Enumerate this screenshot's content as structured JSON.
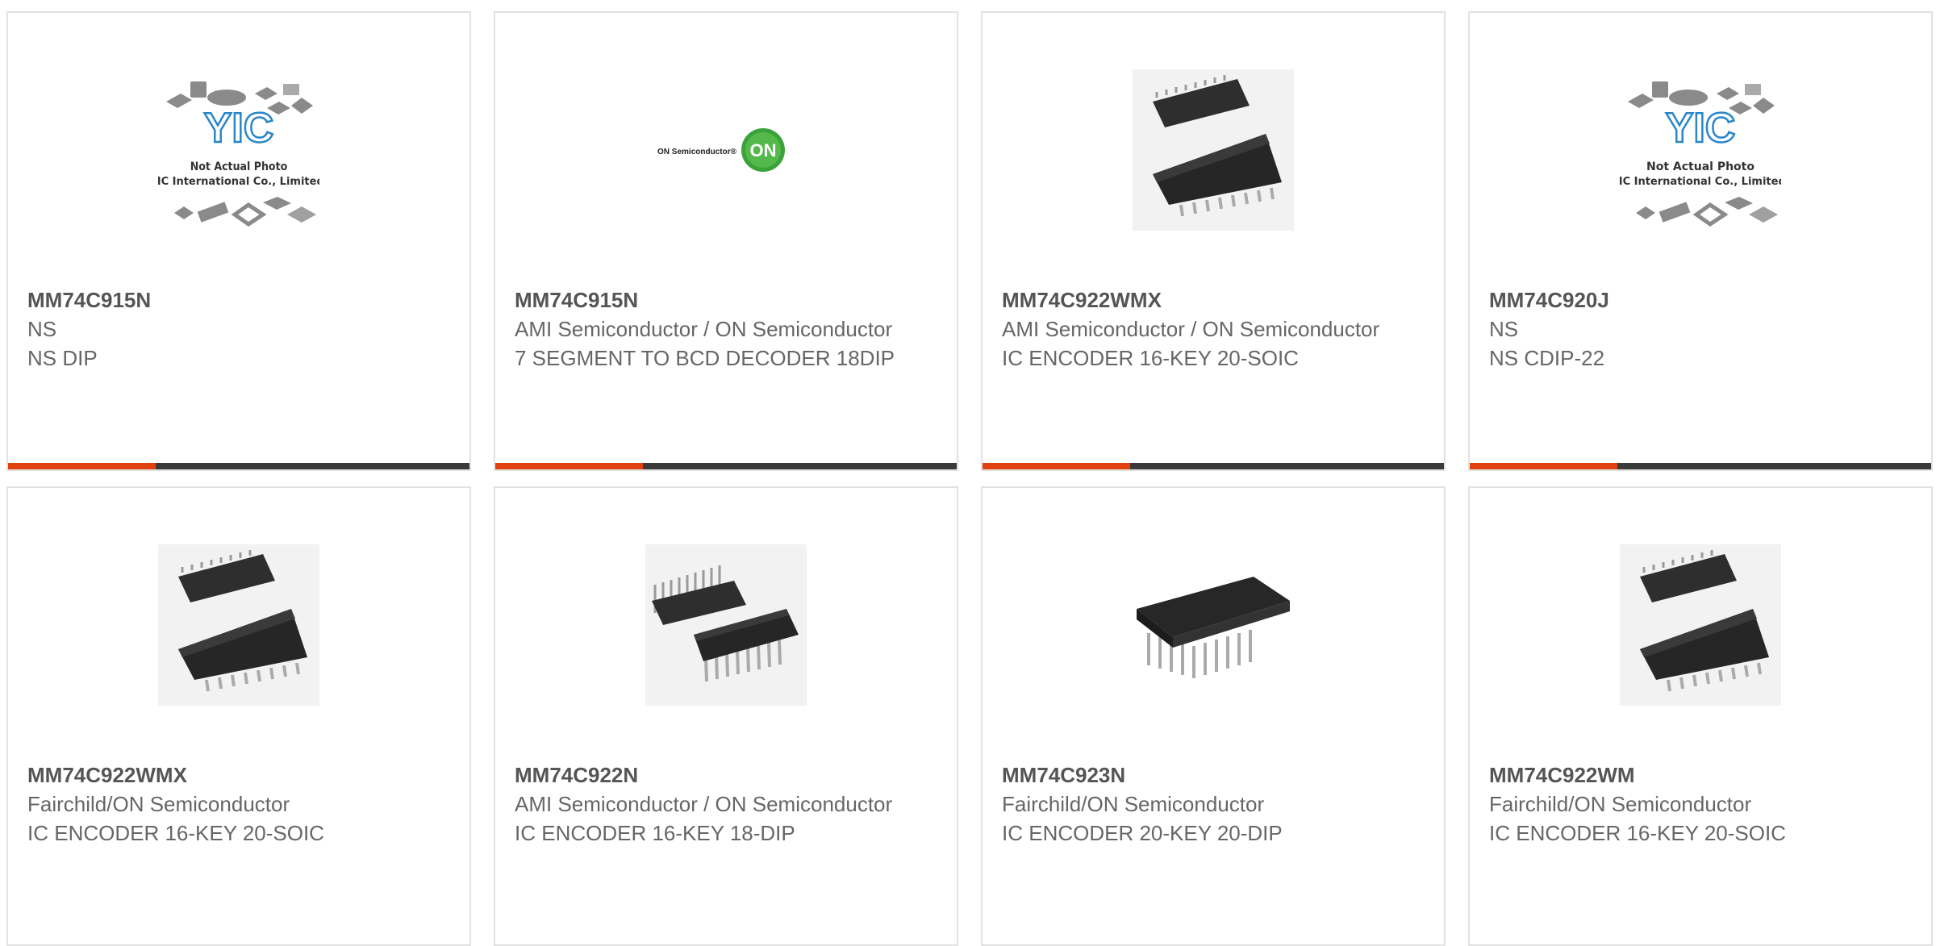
{
  "colors": {
    "accent": "#e2420f",
    "bar": "#3a3a3a",
    "border": "#e2e2e2",
    "text": "#666666"
  },
  "products": [
    {
      "part": "MM74C915N",
      "manufacturer": "NS",
      "description": "NS DIP",
      "image": "yic-placeholder",
      "yic_note1": "Not Actual Photo",
      "yic_note2": "YIC International Co., Limited."
    },
    {
      "part": "MM74C915N",
      "manufacturer": "AMI Semiconductor / ON Semiconductor",
      "description": "7 SEGMENT TO BCD DECODER 18DIP",
      "image": "on-semiconductor-logo",
      "logo_text": "ON Semiconductor®",
      "logo_badge": "ON"
    },
    {
      "part": "MM74C922WMX",
      "manufacturer": "AMI Semiconductor / ON Semiconductor",
      "description": "IC ENCODER 16-KEY 20-SOIC",
      "image": "soic-chip"
    },
    {
      "part": "MM74C920J",
      "manufacturer": "NS",
      "description": "NS CDIP-22",
      "image": "yic-placeholder",
      "yic_note1": "Not Actual Photo",
      "yic_note2": "YIC International Co., Limited."
    },
    {
      "part": "MM74C922WMX",
      "manufacturer": "Fairchild/ON Semiconductor",
      "description": "IC ENCODER 16-KEY 20-SOIC",
      "image": "soic-chip"
    },
    {
      "part": "MM74C922N",
      "manufacturer": "AMI Semiconductor / ON Semiconductor",
      "description": "IC ENCODER 16-KEY 18-DIP",
      "image": "dip-chip"
    },
    {
      "part": "MM74C923N",
      "manufacturer": "Fairchild/ON Semiconductor",
      "description": "IC ENCODER 20-KEY 20-DIP",
      "image": "dip-chip-single"
    },
    {
      "part": "MM74C922WM",
      "manufacturer": "Fairchild/ON Semiconductor",
      "description": "IC ENCODER 16-KEY 20-SOIC",
      "image": "soic-chip"
    }
  ]
}
